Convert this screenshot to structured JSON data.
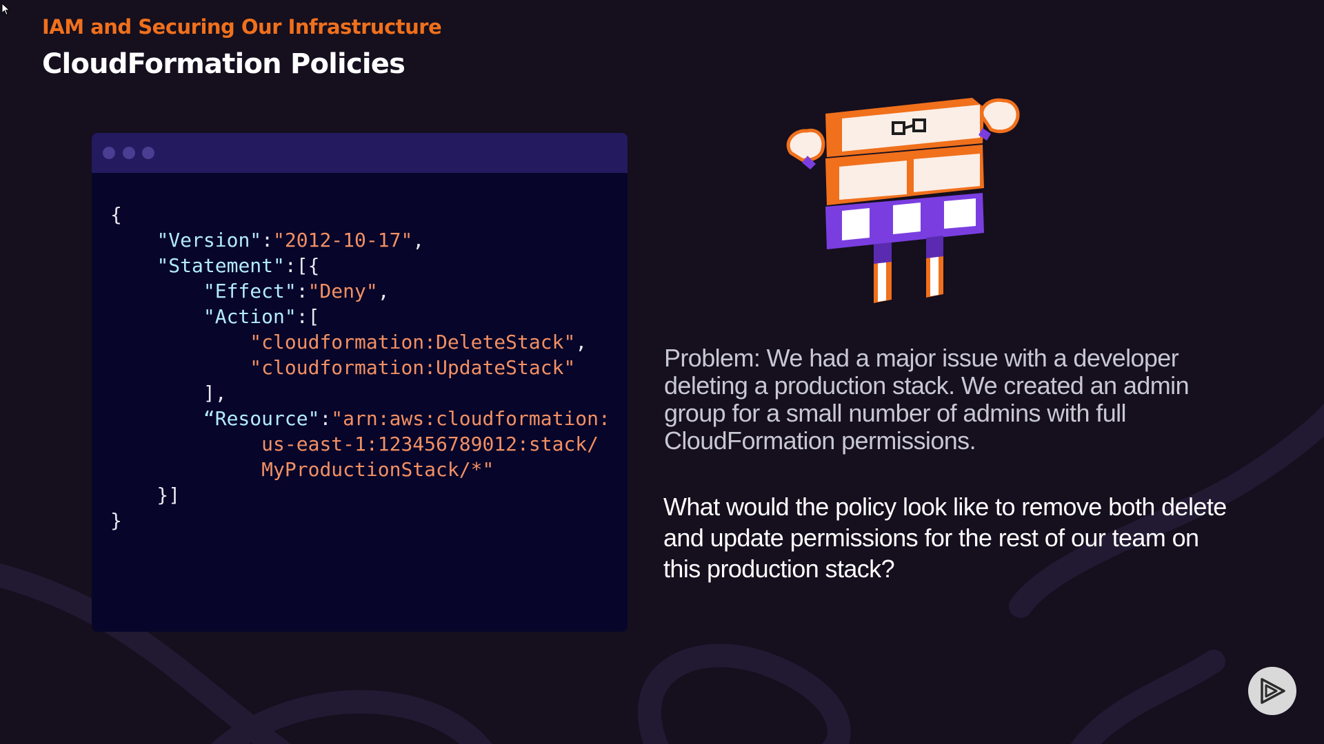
{
  "header": {
    "course_title": "IAM and Securing Our Infrastructure",
    "slide_title": "CloudFormation Policies"
  },
  "code_window": {
    "lines": [
      [
        {
          "t": "{",
          "c": "p"
        }
      ],
      [
        {
          "t": "    ",
          "c": "p"
        },
        {
          "t": "\"Version\"",
          "c": "k"
        },
        {
          "t": ":",
          "c": "p"
        },
        {
          "t": "\"2012-10-17\"",
          "c": "s"
        },
        {
          "t": ",",
          "c": "p"
        }
      ],
      [
        {
          "t": "    ",
          "c": "p"
        },
        {
          "t": "\"Statement\"",
          "c": "k"
        },
        {
          "t": ":[{",
          "c": "p"
        }
      ],
      [
        {
          "t": "        ",
          "c": "p"
        },
        {
          "t": "\"Effect\"",
          "c": "k"
        },
        {
          "t": ":",
          "c": "p"
        },
        {
          "t": "\"Deny\"",
          "c": "s"
        },
        {
          "t": ",",
          "c": "p"
        }
      ],
      [
        {
          "t": "        ",
          "c": "p"
        },
        {
          "t": "\"Action\"",
          "c": "k"
        },
        {
          "t": ":[",
          "c": "p"
        }
      ],
      [
        {
          "t": "            ",
          "c": "p"
        },
        {
          "t": "\"cloudformation:DeleteStack\"",
          "c": "s"
        },
        {
          "t": ",",
          "c": "p"
        }
      ],
      [
        {
          "t": "            ",
          "c": "p"
        },
        {
          "t": "\"cloudformation:UpdateStack\"",
          "c": "s"
        }
      ],
      [
        {
          "t": "        ],",
          "c": "p"
        }
      ],
      [
        {
          "t": "        ",
          "c": "p"
        },
        {
          "t": "“Resource\"",
          "c": "k"
        },
        {
          "t": ":",
          "c": "p"
        },
        {
          "t": "\"arn:aws:cloudformation:",
          "c": "s"
        }
      ],
      [
        {
          "t": "             ",
          "c": "p"
        },
        {
          "t": "us-east-1:123456789012:stack/",
          "c": "s"
        }
      ],
      [
        {
          "t": "             ",
          "c": "p"
        },
        {
          "t": "MyProductionStack/*\"",
          "c": "s"
        }
      ],
      [
        {
          "t": "    }]",
          "c": "p"
        }
      ],
      [
        {
          "t": "}",
          "c": "p"
        }
      ]
    ]
  },
  "problem": {
    "text": "Problem: We had a major issue with a developer deleting a production stack. We created an admin group for a small number of admins with full CloudFormation permissions."
  },
  "question": {
    "text": "What would the policy look like to remove both delete and update permissions for the rest of our team on this production stack?"
  },
  "player": {
    "icon": "play-icon"
  },
  "colors": {
    "background": "#150f1e",
    "accent_orange": "#f0701c",
    "code_background": "#07052a",
    "code_titlebar": "#241a5f",
    "json_key": "#b3ebff",
    "json_string": "#f39063",
    "mascot_purple": "#7a3ee0"
  }
}
